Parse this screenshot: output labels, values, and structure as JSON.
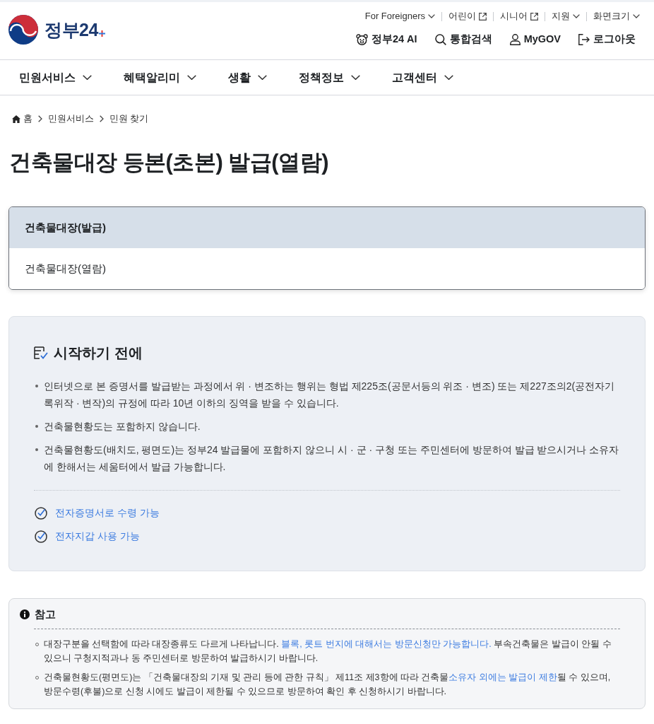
{
  "header": {
    "logo": {
      "text": "정부24"
    },
    "utility_links": [
      {
        "label": "For Foreigners",
        "kind": "dropdown"
      },
      {
        "label": "어린이",
        "kind": "external"
      },
      {
        "label": "시니어",
        "kind": "external"
      },
      {
        "label": "지원",
        "kind": "dropdown"
      },
      {
        "label": "화면크기",
        "kind": "dropdown"
      }
    ],
    "main_links": [
      {
        "label": "정부24 AI",
        "kind": "ai"
      },
      {
        "label": "통합검색",
        "kind": "search"
      },
      {
        "label": "MyGOV",
        "kind": "user"
      },
      {
        "label": "로그아웃",
        "kind": "logout"
      }
    ]
  },
  "nav": {
    "items": [
      "민원서비스",
      "혜택알리미",
      "생활",
      "정책정보",
      "고객센터"
    ]
  },
  "breadcrumb": [
    {
      "label": "홈",
      "kind": "home"
    },
    {
      "label": "민원서비스",
      "kind": "page"
    },
    {
      "label": "민원 찾기",
      "kind": "page"
    }
  ],
  "title": "건축물대장 등본(초본) 발급(열람)",
  "options": [
    {
      "label": "건축물대장(발급)",
      "selected": true
    },
    {
      "label": "건축물대장(열람)",
      "selected": false
    }
  ],
  "before_start": {
    "heading": "시작하기 전에",
    "notes": [
      "인터넷으로 본 증명서를 발급받는 과정에서 위 · 변조하는 행위는 형법 제225조(공문서등의 위조 · 변조) 또는 제227조의2(공전자기록위작 · 변작)의 규정에 따라 10년 이하의 징역을 받을 수 있습니다.",
      "건축물현황도는 포함하지 않습니다.",
      "건축물현황도(배치도, 평면도)는 정부24 발급물에 포함하지 않으니 시 · 군 · 구청 또는 주민센터에 방문하여 발급 받으시거나 소유자에 한해서는 세움터에서 발급 가능합니다."
    ],
    "features": [
      "전자증명서로 수령 가능",
      "전자지갑 사용 가능"
    ]
  },
  "reference": {
    "heading": "참고",
    "items": [
      {
        "segments": [
          {
            "text": "대장구분을 선택함에 따라 대장종류도 다르게 나타납니다. ",
            "kind": "plain"
          },
          {
            "text": "블록, 롯트 번지에 대해서는 방문신청만 가능합니다.",
            "kind": "emphasis"
          },
          {
            "text": " 부속건축물은 발급이 안될 수 있으니 구청지적과나 동 주민센터로 방문하여 발급하시기 바랍니다.",
            "kind": "plain"
          }
        ]
      },
      {
        "segments": [
          {
            "text": "건축물현황도(평면도)는 「건축물대장의 기재 및 관리 등에 관한 규칙」 제11조 제3항에 따라 건축물",
            "kind": "plain"
          },
          {
            "text": "소유자 외에는 발급이 제한",
            "kind": "emphasis"
          },
          {
            "text": "될 수 있으며, 방문수령(후불)으로 신청 시에도 발급이 제한될 수 있으므로 방문하여 확인 후 신청하시기 바랍니다.",
            "kind": "plain"
          }
        ]
      }
    ]
  }
}
